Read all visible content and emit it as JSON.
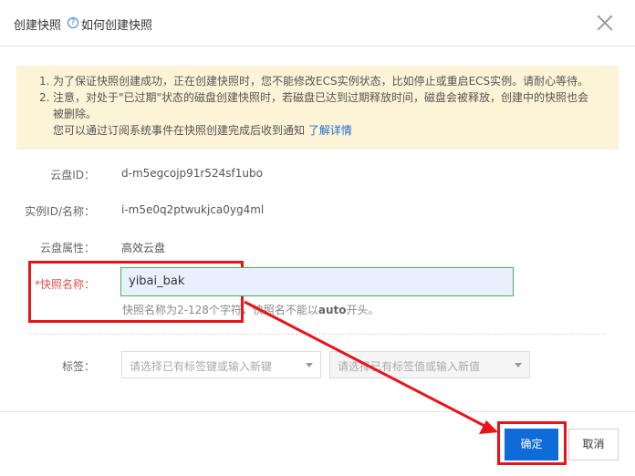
{
  "dialog": {
    "title": "创建快照",
    "help_icon_glyph": "?",
    "help_link": "如何创建快照"
  },
  "notice": {
    "lines": [
      {
        "idx": "1.",
        "text": "为了保证快照创建成功，正在创建快照时，您不能修改ECS实例状态，比如停止或重启ECS实例。请耐心等待。"
      },
      {
        "idx": "2.",
        "text": "注意，对处于\"已过期\"状态的磁盘创建快照时，若磁盘已达到过期释放时间，磁盘会被释放，创建中的快照也会"
      },
      {
        "idx": "",
        "text": "被删除。"
      },
      {
        "idx": "",
        "text": "您可以通过订阅系统事件在快照创建完成后收到通知 "
      }
    ],
    "learn_more": "了解详情"
  },
  "fields": {
    "disk_id_label": "云盘ID：",
    "disk_id_value": "d-m5egcojp91r524sf1ubo",
    "instance_label": "实例ID/名称：",
    "instance_value": "i-m5e0q2ptwukjca0yg4ml",
    "disk_attr_label": "云盘属性：",
    "disk_attr_value": "高效云盘",
    "snapshot_name_label": "*快照名称：",
    "snapshot_name_value": "yibai_bak",
    "hint_prefix": "快照名称为2-128个字符，快照名不能以",
    "hint_bold": "auto",
    "hint_suffix": "开头。",
    "tags_label": "标签：",
    "tag_key_placeholder": "请选择已有标签键或输入新键",
    "tag_value_placeholder": "请选择已有标签值或输入新值"
  },
  "buttons": {
    "confirm": "确定",
    "cancel": "取消"
  },
  "colors": {
    "annotation_red": "#e8141a",
    "primary_blue": "#0f6bd8",
    "notice_bg": "#fdf3d7"
  }
}
